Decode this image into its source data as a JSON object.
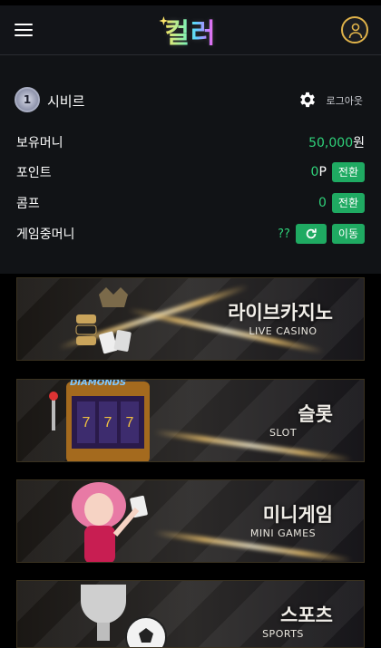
{
  "header": {
    "logo_text": "컬러",
    "menu_icon": "hamburger-menu-icon",
    "user_icon": "user-icon",
    "accent": "#e0b34a"
  },
  "profile": {
    "level": "1",
    "username": "시비르",
    "settings_icon": "gear-icon",
    "logout_label": "로그아웃"
  },
  "wallet": {
    "money_label": "보유머니",
    "money_value": "50,000",
    "money_unit": "원",
    "point_label": "포인트",
    "point_value": "0",
    "point_unit": "P",
    "point_button": "전환",
    "comp_label": "콤프",
    "comp_value": "0",
    "comp_button": "전환",
    "game_money_label": "게임중머니",
    "game_money_value": "??",
    "refresh_icon": "refresh-icon",
    "move_button": "이동",
    "green": "#2fd27a",
    "button_color": "#1faa62"
  },
  "banners": [
    {
      "title": "라이브카지노",
      "subtitle": "LIVE CASINO"
    },
    {
      "title": "슬롯",
      "subtitle": "SLOT"
    },
    {
      "title": "미니게임",
      "subtitle": "MINI GAMES"
    },
    {
      "title": "스포츠",
      "subtitle": "SPORTS"
    }
  ],
  "slot_art_text": "DIAMONDS"
}
